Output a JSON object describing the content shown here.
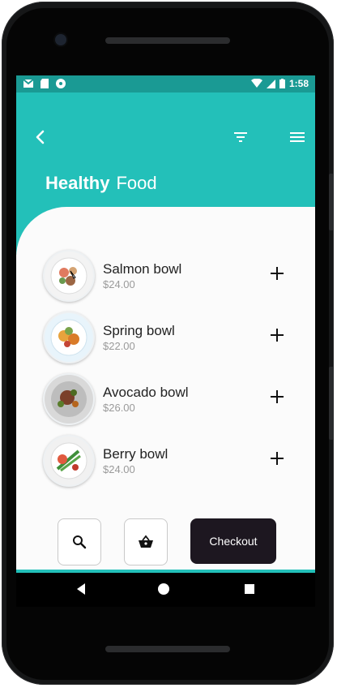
{
  "status_bar": {
    "time": "1:58"
  },
  "header": {
    "title_bold": "Healthy",
    "title_rest": "Food"
  },
  "items": [
    {
      "name": "Salmon bowl",
      "price": "$24.00"
    },
    {
      "name": "Spring bowl",
      "price": "$22.00"
    },
    {
      "name": "Avocado bowl",
      "price": "$26.00"
    },
    {
      "name": "Berry bowl",
      "price": "$24.00"
    }
  ],
  "actions": {
    "checkout_label": "Checkout"
  },
  "colors": {
    "accent": "#23c0b9",
    "statusbar": "#1a9a94",
    "checkout": "#1d1720"
  },
  "icons": [
    "back-arrow-icon",
    "filter-icon",
    "menu-icon",
    "plus-icon",
    "search-icon",
    "basket-icon"
  ]
}
